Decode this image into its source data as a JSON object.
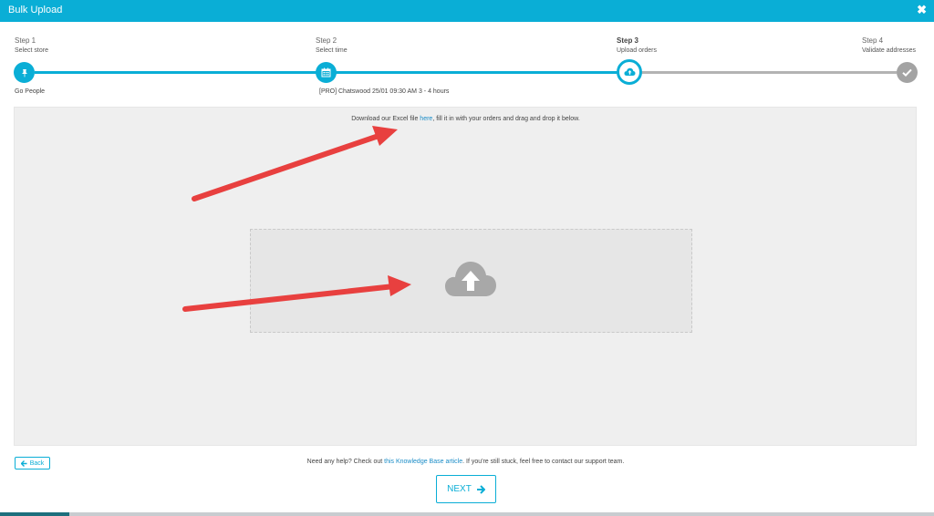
{
  "window": {
    "title": "Bulk Upload",
    "close_icon": "close-icon"
  },
  "steps": [
    {
      "title": "Step 1",
      "subtitle": "Select store",
      "value": "Go People",
      "state": "done",
      "icon": "pin-icon"
    },
    {
      "title": "Step 2",
      "subtitle": "Select time",
      "value": "[PRO] Chatswood 25/01 09:30 AM 3 - 4 hours",
      "state": "done",
      "icon": "calendar-icon"
    },
    {
      "title": "Step 3",
      "subtitle": "Upload orders",
      "value": "",
      "state": "active",
      "icon": "cloud-upload-icon"
    },
    {
      "title": "Step 4",
      "subtitle": "Validate addresses",
      "value": "",
      "state": "pending",
      "icon": "check-icon"
    }
  ],
  "upload": {
    "instruction_prefix": "Download our Excel file ",
    "instruction_link": "here",
    "instruction_suffix": ", fill it in with your orders and drag and drop it below.",
    "dropzone_icon": "cloud-upload-icon"
  },
  "footer": {
    "back_label": "Back",
    "help_prefix": "Need any help? Check out ",
    "help_link": "this Knowledge Base article",
    "help_suffix": ". If you're still stuck, feel free to contact our support team.",
    "next_label": "NEXT"
  },
  "colors": {
    "accent": "#0aaed6",
    "pending": "#a3a3a3",
    "annotation_arrow": "#e8403f"
  }
}
